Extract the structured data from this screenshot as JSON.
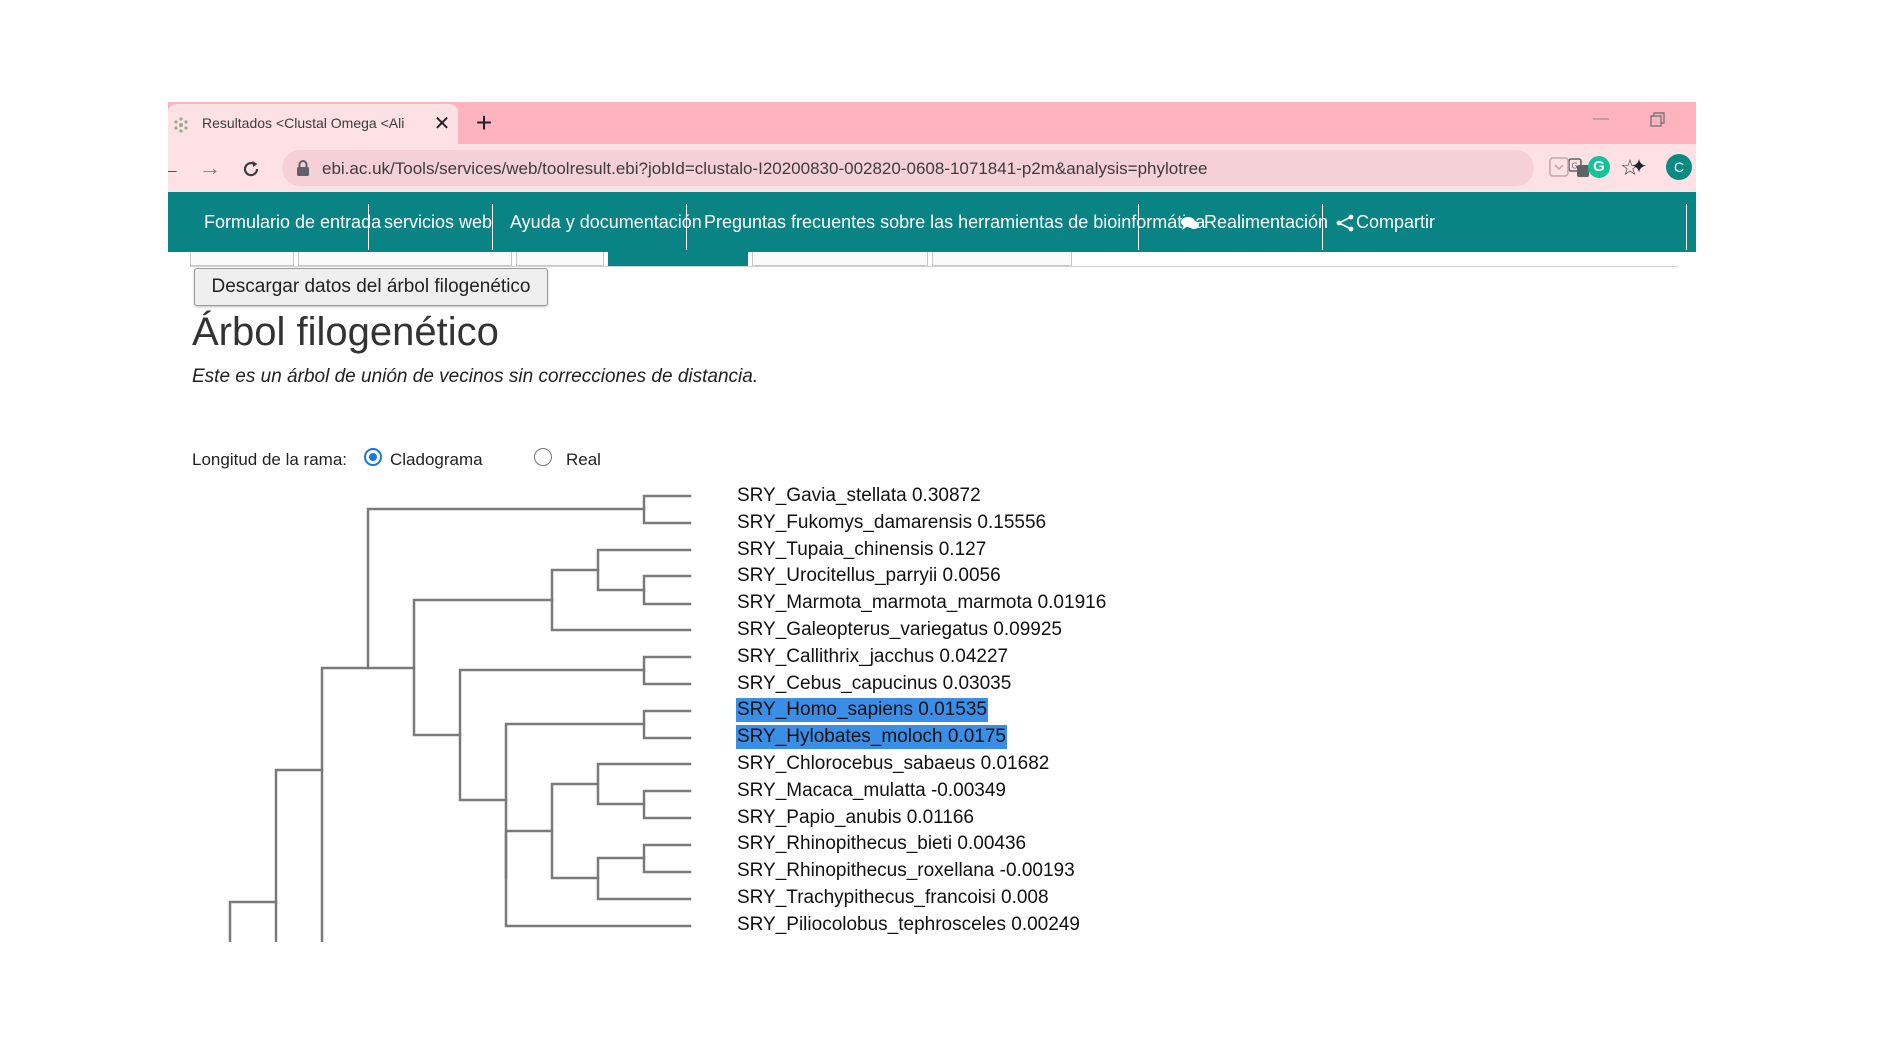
{
  "browser": {
    "tab_title": "Resultados <Clustal Omega <Ali",
    "url": "ebi.ac.uk/Tools/services/web/toolresult.ebi?jobId=clustalo-I20200830-002820-0608-1071841-p2m&analysis=phylotree",
    "profile_initial": "C",
    "grammarly_letter": "G"
  },
  "ebi_nav": {
    "items": [
      "Formulario de entrada",
      "servicios web",
      "Ayuda y documentación",
      "Preguntas frecuentes sobre las herramientas de bioinformática"
    ],
    "feedback": "Realimentación",
    "share": "Compartir"
  },
  "download_button": "Descargar datos del árbol filogenético",
  "title": "Árbol filogenético",
  "description": "Este es un árbol de unión de vecinos sin correcciones de distancia.",
  "branch_length": {
    "label": "Longitud de la rama:",
    "options": [
      "Cladograma",
      "Real"
    ],
    "selected": "Cladograma"
  },
  "tree": {
    "leaves": [
      {
        "label": "SRY_Gavia_stellata 0.30872",
        "selected": false
      },
      {
        "label": "SRY_Fukomys_damarensis 0.15556",
        "selected": false
      },
      {
        "label": "SRY_Tupaia_chinensis 0.127",
        "selected": false
      },
      {
        "label": "SRY_Urocitellus_parryii 0.0056",
        "selected": false
      },
      {
        "label": "SRY_Marmota_marmota_marmota 0.01916",
        "selected": false
      },
      {
        "label": "SRY_Galeopterus_variegatus 0.09925",
        "selected": false
      },
      {
        "label": "SRY_Callithrix_jacchus 0.04227",
        "selected": false
      },
      {
        "label": "SRY_Cebus_capucinus 0.03035",
        "selected": false
      },
      {
        "label": "SRY_Homo_sapiens 0.01535",
        "selected": true
      },
      {
        "label": "SRY_Hylobates_moloch 0.0175",
        "selected": true
      },
      {
        "label": "SRY_Chlorocebus_sabaeus 0.01682",
        "selected": false
      },
      {
        "label": "SRY_Macaca_mulatta -0.00349",
        "selected": false
      },
      {
        "label": "SRY_Papio_anubis 0.01166",
        "selected": false
      },
      {
        "label": "SRY_Rhinopithecus_bieti 0.00436",
        "selected": false
      },
      {
        "label": "SRY_Rhinopithecus_roxellana -0.00193",
        "selected": false
      },
      {
        "label": "SRY_Trachypithecus_francoisi 0.008",
        "selected": false
      },
      {
        "label": "SRY_Piliocolobus_tephrosceles 0.00249",
        "selected": false
      }
    ]
  },
  "colors": {
    "tab_strip": "#ffb3bf",
    "nav_teal": "#0a8385",
    "selection": "#3a8ee6"
  }
}
